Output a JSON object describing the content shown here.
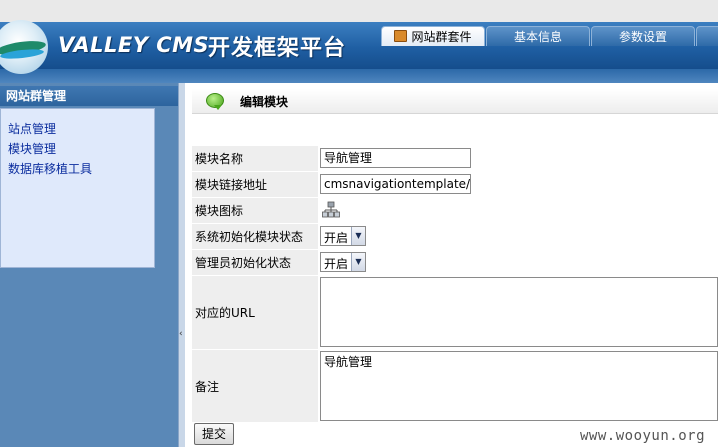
{
  "header": {
    "brand": "VALLEY CMS",
    "title_cn": "开发框架平台",
    "tabs": [
      {
        "label": "网站群套件",
        "active": true
      },
      {
        "label": "基本信息",
        "active": false
      },
      {
        "label": "参数设置",
        "active": false
      }
    ]
  },
  "sidebar": {
    "title": "网站群管理",
    "items": [
      {
        "label": "站点管理"
      },
      {
        "label": "模块管理"
      },
      {
        "label": "数据库移植工具"
      }
    ]
  },
  "main": {
    "title": "编辑模块",
    "fields": {
      "module_name": {
        "label": "模块名称",
        "value": "导航管理"
      },
      "module_link": {
        "label": "模块链接地址",
        "value": "cmsnavigationtemplate/ma"
      },
      "module_icon": {
        "label": "模块图标",
        "icon": "org-tree-icon"
      },
      "system_init_state": {
        "label": "系统初始化模块状态",
        "value": "开启"
      },
      "admin_init_state": {
        "label": "管理员初始化状态",
        "value": "开启"
      },
      "url": {
        "label": "对应的URL",
        "value": ""
      },
      "remark": {
        "label": "备注",
        "value": "导航管理"
      }
    },
    "submit_label": "提交"
  },
  "watermark": "www.wooyun.org"
}
